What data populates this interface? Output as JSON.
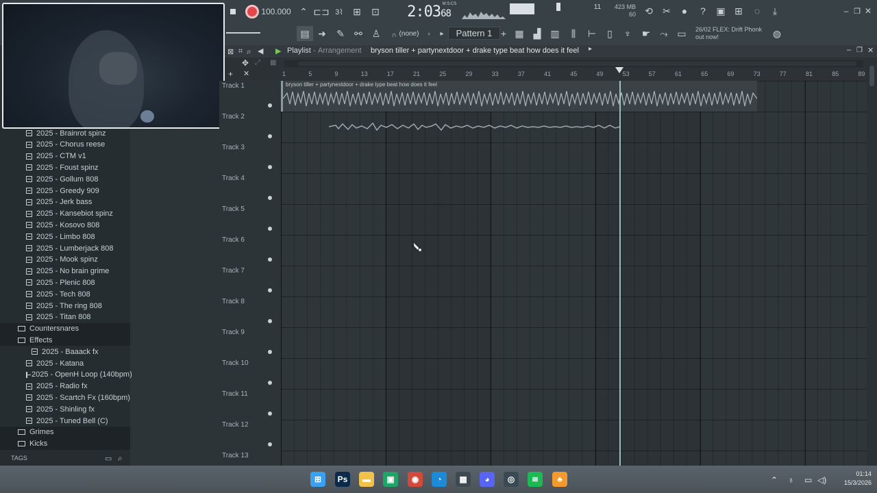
{
  "toolbar": {
    "tempo": "100.000",
    "time": "2:03",
    "time_small": "68",
    "time_unit": "M:S:CS",
    "cpu_value": "11",
    "memory": "423 MB",
    "memory2": "60",
    "pattern_selector": "(none)",
    "pattern_name": "Pattern 1",
    "news_line1": "26/02  FLEX: Drift Phonk",
    "news_line2": "out now!"
  },
  "playlist": {
    "title": "Playlist",
    "breadcrumb_separator": "-",
    "view": "Arrangement",
    "project": "bryson tiller + partynextdoor + drake type beat how does it feel",
    "clip_name": "bryson tiller + partynextdoor + drake type beat how does it feel",
    "ruler": [
      "1",
      "5",
      "9",
      "13",
      "17",
      "21",
      "25",
      "29",
      "33",
      "37",
      "41",
      "45",
      "49",
      "53",
      "57",
      "61",
      "65",
      "69",
      "73",
      "77",
      "81",
      "85",
      "89"
    ],
    "tracks": [
      "Track 1",
      "Track 2",
      "Track 3",
      "Track 4",
      "Track 5",
      "Track 6",
      "Track 7",
      "Track 8",
      "Track 9",
      "Track 10",
      "Track 11",
      "Track 12",
      "Track 13"
    ]
  },
  "browser": {
    "items": [
      {
        "type": "file",
        "label": "2025 - Brainrot spinz",
        "indent": 38
      },
      {
        "type": "file",
        "label": "2025 - Chorus reese",
        "indent": 38
      },
      {
        "type": "file",
        "label": "2025 - CTM v1",
        "indent": 38
      },
      {
        "type": "file",
        "label": "2025 - Foust spinz",
        "indent": 38
      },
      {
        "type": "file",
        "label": "2025 - Gollum 808",
        "indent": 38
      },
      {
        "type": "file",
        "label": "2025 - Greedy 909",
        "indent": 38
      },
      {
        "type": "file",
        "label": "2025 - Jerk bass",
        "indent": 38
      },
      {
        "type": "file",
        "label": "2025 - Kansebiot spinz",
        "indent": 38
      },
      {
        "type": "file",
        "label": "2025 - Kosovo 808",
        "indent": 38
      },
      {
        "type": "file",
        "label": "2025 - Limbo 808",
        "indent": 38
      },
      {
        "type": "file",
        "label": "2025 - Lumberjack 808",
        "indent": 38
      },
      {
        "type": "file",
        "label": "2025 - Mook spinz",
        "indent": 38
      },
      {
        "type": "file",
        "label": "2025 - No brain grime",
        "indent": 38
      },
      {
        "type": "file",
        "label": "2025 - Plenic 808",
        "indent": 38
      },
      {
        "type": "file",
        "label": "2025 - Tech 808",
        "indent": 38
      },
      {
        "type": "file",
        "label": "2025 - The ring 808",
        "indent": 38
      },
      {
        "type": "file",
        "label": "2025 - Titan 808",
        "indent": 38
      },
      {
        "type": "folder",
        "label": "Countersnares",
        "indent": 26
      },
      {
        "type": "folder",
        "label": "Effects",
        "indent": 26
      },
      {
        "type": "file",
        "label": "2025 - Baaack fx",
        "indent": 46
      },
      {
        "type": "file",
        "label": "2025 - Katana",
        "indent": 38
      },
      {
        "type": "file",
        "label": "2025 - OpenH Loop (140bpm)",
        "indent": 38
      },
      {
        "type": "file",
        "label": "2025 - Radio fx",
        "indent": 38
      },
      {
        "type": "file",
        "label": "2025 - Scartch Fx (160bpm)",
        "indent": 38
      },
      {
        "type": "file",
        "label": "2025 - Shinling fx",
        "indent": 38
      },
      {
        "type": "file",
        "label": "2025 - Tuned Bell (C)",
        "indent": 38
      },
      {
        "type": "folder",
        "label": "Grimes",
        "indent": 26
      },
      {
        "type": "folder",
        "label": "Kicks",
        "indent": 26
      }
    ],
    "tags_label": "TAGS"
  },
  "taskbar": {
    "time": "01:14",
    "date": "15/3/2026",
    "apps": [
      {
        "name": "windows-start-icon",
        "glyph": "⊞",
        "color": "#3aa0f0"
      },
      {
        "name": "photoshop-icon",
        "glyph": "Ps",
        "color": "#0b2a4a"
      },
      {
        "name": "file-explorer-icon",
        "glyph": "▬",
        "color": "#f1c24b"
      },
      {
        "name": "green-app-icon",
        "glyph": "▣",
        "color": "#1ea568"
      },
      {
        "name": "chrome-icon",
        "glyph": "◉",
        "color": "#d34a3c"
      },
      {
        "name": "edge-icon",
        "glyph": "◔",
        "color": "#1c8ad6"
      },
      {
        "name": "store-icon",
        "glyph": "▦",
        "color": "#3d4a52"
      },
      {
        "name": "discord-icon",
        "glyph": "◕",
        "color": "#5865f2"
      },
      {
        "name": "steam-icon",
        "glyph": "◎",
        "color": "#3a4a55"
      },
      {
        "name": "spotify-icon",
        "glyph": "≋",
        "color": "#1db954"
      },
      {
        "name": "fl-studio-icon",
        "glyph": "♣",
        "color": "#f29a2e"
      }
    ]
  }
}
